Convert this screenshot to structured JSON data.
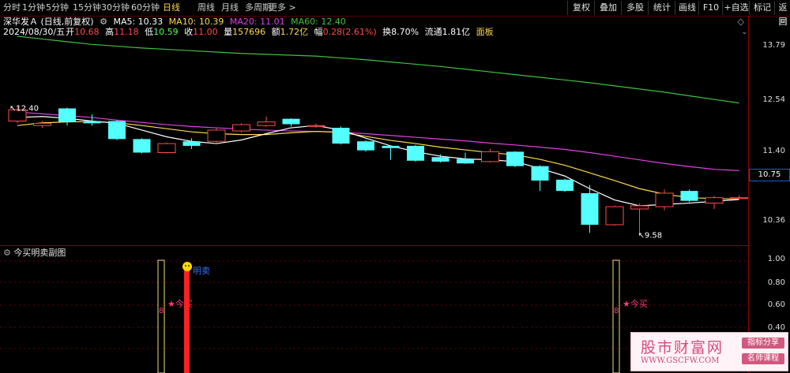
{
  "toolbar": {
    "periods": [
      "分时",
      "1分钟",
      "5分钟",
      "15分钟",
      "30分钟",
      "60分钟",
      "日线",
      "周线",
      "月线",
      "多周期",
      "更多 >"
    ],
    "active": "日线",
    "right_buttons": [
      "复权",
      "叠加",
      "多股",
      "统计",
      "画线",
      "F10",
      "+自选",
      "标记",
      "返回"
    ]
  },
  "stock": {
    "name": "深华发Ａ (日线,前复权)",
    "ma5": "MA5: 10.33",
    "ma10": "MA10: 10.39",
    "ma20": "MA20: 11.01",
    "ma60": "MA60: 12.40",
    "date": "2024/08/30/五",
    "open_l": "开",
    "open": "10.68",
    "high_l": "高",
    "high": "11.18",
    "low_l": "低",
    "low": "10.59",
    "close_l": "收",
    "close": "11.00",
    "vol_l": "量",
    "vol": "157696",
    "amt_l": "额",
    "amt": "1.72亿",
    "chg_l": "幅",
    "chg": "0.28(2.61%)",
    "turnover": "换8.70%",
    "float": "流通1.81亿",
    "board": "面板"
  },
  "price_axis": [
    "13.79",
    "12.54",
    "11.40",
    "10.36"
  ],
  "current_price": "10.75",
  "high_marker": "12.40",
  "low_marker": "9.58",
  "sub_chart": {
    "title": "今买明卖副图",
    "axis": [
      "1.00",
      "0.80",
      "0.60",
      "0.40"
    ],
    "buy_label": "今买",
    "sell_label": "明卖",
    "marker_digit": "8"
  },
  "watermark": {
    "main": "股市财富网",
    "url": "WWW.GSCFW.COM",
    "tag1": "指标分享",
    "tag2": "名师课程"
  },
  "colors": {
    "up": "#ff4b4b",
    "down": "#54ffff",
    "ma5": "#ffffff",
    "ma10": "#ffd84a",
    "ma20": "#e040e0",
    "ma60": "#40c040"
  },
  "chart_data": {
    "type": "candlestick",
    "candles": [
      {
        "o": 12.1,
        "c": 12.35,
        "h": 12.45,
        "l": 12.05
      },
      {
        "o": 12.0,
        "c": 12.05,
        "h": 12.1,
        "l": 11.95
      },
      {
        "o": 12.38,
        "c": 12.08,
        "h": 12.4,
        "l": 12.0
      },
      {
        "o": 12.1,
        "c": 12.05,
        "h": 12.25,
        "l": 12.0
      },
      {
        "o": 12.1,
        "c": 11.7,
        "h": 12.12,
        "l": 11.68
      },
      {
        "o": 11.7,
        "c": 11.4,
        "h": 11.72,
        "l": 11.38
      },
      {
        "o": 11.4,
        "c": 11.6,
        "h": 11.62,
        "l": 11.38
      },
      {
        "o": 11.65,
        "c": 11.55,
        "h": 11.72,
        "l": 11.48
      },
      {
        "o": 11.65,
        "c": 11.9,
        "h": 11.95,
        "l": 11.62
      },
      {
        "o": 11.88,
        "c": 12.02,
        "h": 12.05,
        "l": 11.85
      },
      {
        "o": 12.0,
        "c": 12.08,
        "h": 12.2,
        "l": 11.97
      },
      {
        "o": 12.15,
        "c": 12.03,
        "h": 12.16,
        "l": 11.98
      },
      {
        "o": 11.98,
        "c": 12.0,
        "h": 12.04,
        "l": 11.95
      },
      {
        "o": 11.95,
        "c": 11.6,
        "h": 11.98,
        "l": 11.58
      },
      {
        "o": 11.65,
        "c": 11.45,
        "h": 11.67,
        "l": 11.42
      },
      {
        "o": 11.55,
        "c": 11.5,
        "h": 11.56,
        "l": 11.24
      },
      {
        "o": 11.55,
        "c": 11.22,
        "h": 11.57,
        "l": 11.2
      },
      {
        "o": 11.3,
        "c": 11.2,
        "h": 11.36,
        "l": 11.18
      },
      {
        "o": 11.26,
        "c": 11.16,
        "h": 11.4,
        "l": 11.15
      },
      {
        "o": 11.2,
        "c": 11.42,
        "h": 11.48,
        "l": 11.18
      },
      {
        "o": 11.42,
        "c": 11.1,
        "h": 11.43,
        "l": 11.08
      },
      {
        "o": 11.1,
        "c": 10.78,
        "h": 11.12,
        "l": 10.55
      },
      {
        "o": 10.8,
        "c": 10.55,
        "h": 10.82,
        "l": 10.53
      },
      {
        "o": 10.5,
        "c": 9.8,
        "h": 10.68,
        "l": 9.62
      },
      {
        "o": 9.8,
        "c": 10.2,
        "h": 10.22,
        "l": 9.78
      },
      {
        "o": 10.15,
        "c": 10.22,
        "h": 10.27,
        "l": 9.58
      },
      {
        "o": 10.2,
        "c": 10.5,
        "h": 10.58,
        "l": 10.12
      },
      {
        "o": 10.55,
        "c": 10.33,
        "h": 10.58,
        "l": 10.3
      },
      {
        "o": 10.28,
        "c": 10.4,
        "h": 10.44,
        "l": 10.15
      },
      {
        "o": 10.38,
        "c": 10.4,
        "h": 10.45,
        "l": 10.35
      }
    ],
    "ma5": [
      12.18,
      12.2,
      12.16,
      12.1,
      12.05,
      11.9,
      11.75,
      11.65,
      11.6,
      11.68,
      11.82,
      11.95,
      12.0,
      11.9,
      11.72,
      11.55,
      11.42,
      11.32,
      11.26,
      11.24,
      11.2,
      11.05,
      10.88,
      10.6,
      10.35,
      10.22,
      10.25,
      10.28,
      10.32,
      10.36
    ],
    "ma10": [
      12.0,
      12.06,
      12.08,
      12.09,
      12.06,
      12.0,
      11.93,
      11.86,
      11.82,
      11.8,
      11.8,
      11.84,
      11.87,
      11.85,
      11.76,
      11.67,
      11.6,
      11.52,
      11.46,
      11.4,
      11.35,
      11.25,
      11.12,
      10.95,
      10.78,
      10.6,
      10.48,
      10.4,
      10.38,
      10.37
    ],
    "ma20": [
      12.3,
      12.26,
      12.22,
      12.18,
      12.12,
      12.07,
      12.02,
      11.98,
      11.95,
      11.92,
      11.9,
      11.88,
      11.87,
      11.85,
      11.82,
      11.78,
      11.74,
      11.7,
      11.66,
      11.61,
      11.57,
      11.52,
      11.47,
      11.4,
      11.32,
      11.24,
      11.16,
      11.09,
      11.03,
      11.0
    ],
    "ma60": [
      13.98,
      13.92,
      13.86,
      13.8,
      13.76,
      13.72,
      13.69,
      13.66,
      13.63,
      13.6,
      13.58,
      13.56,
      13.54,
      13.5,
      13.46,
      13.41,
      13.36,
      13.31,
      13.25,
      13.19,
      13.13,
      13.07,
      13.01,
      12.95,
      12.88,
      12.81,
      12.74,
      12.66,
      12.58,
      12.5
    ],
    "ylim": [
      9.45,
      14.05
    ]
  }
}
